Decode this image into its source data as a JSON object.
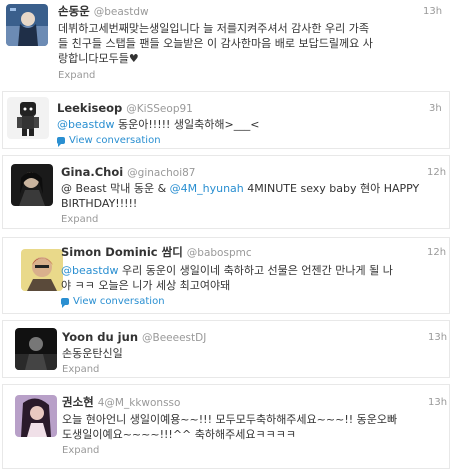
{
  "colors": {
    "link": "#2a8fd1",
    "meta": "#999999",
    "text": "#333333"
  },
  "tweets": [
    {
      "name": "손동운",
      "handle": "@beastdw",
      "time": "13h",
      "lines": [
        "데뷔하고세번째맞는생일입니다 늘 저를지켜주셔서 감사한 우리 가족",
        "들 친구들 스탭들 팬들 오늘받은 이 감사한마음 배로 보답드릴께요 사",
        "랑합니다모두들♥"
      ],
      "action": "Expand"
    },
    {
      "name": "Leekiseop",
      "handle": "@KiSSeop91",
      "time": "3h",
      "mention": "@beastdw",
      "line1_rest": " 동운아!!!!! 생일축하해>___<",
      "action": "View conversation",
      "action_icon": "conversation-icon"
    },
    {
      "name": "Gina.Choi",
      "handle": "@ginachoi87",
      "time": "12h",
      "line1_start": "@ Beast 막내 동운 & ",
      "mention": "@4M_hyunah",
      "line1_rest": " 4MINUTE sexy baby 현아 HAPPY",
      "line2": "BIRTHDAY!!!!!",
      "action": "Expand"
    },
    {
      "name": "Simon Dominic 쌈디",
      "handle": "@babospmc",
      "time": "12h",
      "mention": "@beastdw",
      "line1_rest": " 우리 동운이 생일이네 축하하고 선물은 언젠간 만나게 될 나",
      "line2": "야 ㅋㅋ 오늘은 니가 세상 최고여야돼",
      "action": "View conversation",
      "action_icon": "conversation-icon"
    },
    {
      "name": "Yoon du jun",
      "handle": "@BeeeestDJ",
      "time": "13h",
      "lines": [
        "손동운탄신일"
      ],
      "action": "Expand"
    },
    {
      "name": "권소현",
      "handle": "4@M_kkwonsso",
      "time": "13h",
      "lines": [
        "오늘 현아언니 생일이예용~~!!! 모두모두축하해주세요~~~!! 동운오빠",
        "도생일이예요~~~~!!!^^ 축하해주세요ㅋㅋㅋㅋ"
      ],
      "action": "Expand"
    }
  ]
}
